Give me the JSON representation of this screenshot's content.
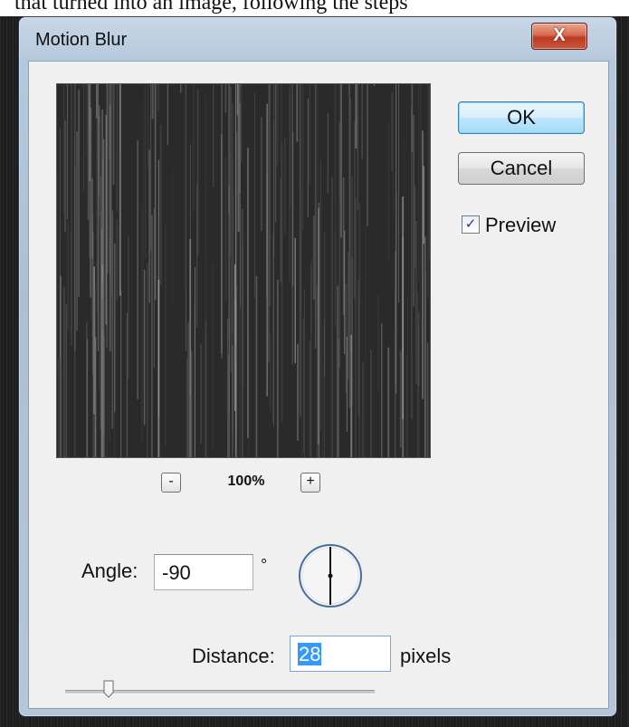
{
  "caption_text": "that turned into an image, following the steps",
  "window": {
    "title": "Motion Blur",
    "close_glyph": "X"
  },
  "preview": {
    "zoom_out_label": "-",
    "zoom_level": "100%",
    "zoom_in_label": "+"
  },
  "buttons": {
    "ok": "OK",
    "cancel": "Cancel"
  },
  "preview_checkbox": {
    "checked": true,
    "mark": "✓",
    "label": "Preview"
  },
  "angle": {
    "label": "Angle:",
    "value": "-90",
    "unit": "°"
  },
  "distance": {
    "label": "Distance:",
    "value": "28",
    "unit": "pixels"
  },
  "slider": {
    "fraction": 0.14
  },
  "icons": {
    "close": "close-icon",
    "dial": "angle-dial-icon",
    "zoom_out": "minus-icon",
    "zoom_in": "plus-icon",
    "check": "check-icon"
  },
  "colors": {
    "selection": "#3399ff",
    "close_button": "#c9553a",
    "default_button": "#bee6fd"
  }
}
